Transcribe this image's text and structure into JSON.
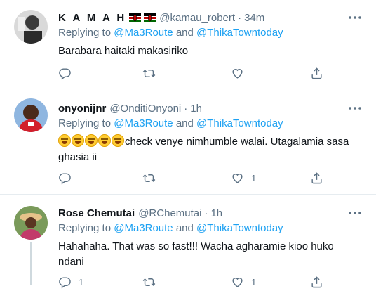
{
  "tweets": [
    {
      "name": "K A M A H",
      "flags": [
        "kenya-flag",
        "kenya-flag"
      ],
      "handle": "@kamau_robert",
      "separator": "·",
      "time": "34m",
      "replying_prefix": "Replying to ",
      "mention1": "@Ma3Route",
      "and": " and ",
      "mention2": "@ThikaTowntoday",
      "text": "Barabara haitaki makasiriko",
      "counts": {
        "reply": "",
        "retweet": "",
        "like": ""
      }
    },
    {
      "name": "onyonijnr",
      "handle": "@OnditiOnyoni",
      "separator": "·",
      "time": "1h",
      "replying_prefix": "Replying to ",
      "mention1": "@Ma3Route",
      "and": " and ",
      "mention2": "@ThikaTowntoday",
      "emojis": [
        "face-with-tears-of-joy",
        "face-with-tears-of-joy",
        "face-with-tears-of-joy",
        "face-with-tears-of-joy",
        "face-with-tears-of-joy"
      ],
      "text": "check venye nimhumble walai. Utagalamia sasa ghasia ii",
      "counts": {
        "reply": "",
        "retweet": "",
        "like": "1"
      }
    },
    {
      "name": "Rose Chemutai",
      "handle": "@RChemutai",
      "separator": "·",
      "time": "1h",
      "replying_prefix": "Replying to ",
      "mention1": "@Ma3Route",
      "and": " and ",
      "mention2": "@ThikaTowntoday",
      "text": "Hahahaha. That was so fast!!! Wacha agharamie kioo huko ndani",
      "counts": {
        "reply": "1",
        "retweet": "",
        "like": "1"
      }
    }
  ],
  "colors": {
    "accent": "#1da1f2",
    "secondary_text": "#5b7083",
    "icon": "#5b7083"
  }
}
